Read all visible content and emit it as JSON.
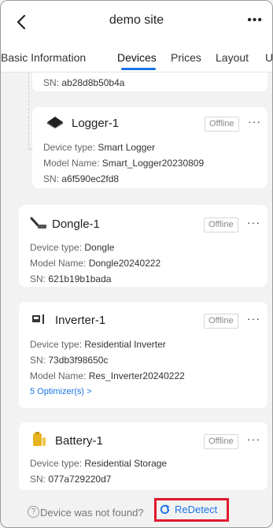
{
  "header": {
    "title": "demo site",
    "back_icon": "chevron-left-icon",
    "more_label": "•••"
  },
  "tabs": [
    {
      "label": "Basic Information"
    },
    {
      "label": "Devices",
      "active": true
    },
    {
      "label": "Prices"
    },
    {
      "label": "Layout"
    },
    {
      "label": "Us"
    }
  ],
  "labels": {
    "device_type": "Device type:",
    "model_name": "Model Name:",
    "sn": "SN:"
  },
  "devices": [
    {
      "sn": "ab28d8b50b4a"
    },
    {
      "name": "Logger-1",
      "status": "Offline",
      "icon": "logger-icon",
      "device_type": "Smart Logger",
      "model_name": "Smart_Logger20230809",
      "sn": "a6f590ec2fd8"
    },
    {
      "name": "Dongle-1",
      "status": "Offline",
      "icon": "dongle-icon",
      "device_type": "Dongle",
      "model_name": "Dongle20240222",
      "sn": "621b19b1bada"
    },
    {
      "name": "Inverter-1",
      "status": "Offline",
      "icon": "inverter-icon",
      "device_type": "Residential Inverter",
      "sn": "73db3f98650c",
      "model_name": "Res_Inverter20240222",
      "optimizers": "5 Optimizer(s) >"
    },
    {
      "name": "Battery-1",
      "status": "Offline",
      "icon": "battery-icon",
      "device_type": "Residential Storage",
      "sn": "077a729220d7"
    }
  ],
  "footer": {
    "not_found": "Device was not found?",
    "redetect": "ReDetect",
    "help_icon": "?"
  },
  "colors": {
    "accent": "#1a73e8",
    "highlight": "#e0182e"
  }
}
